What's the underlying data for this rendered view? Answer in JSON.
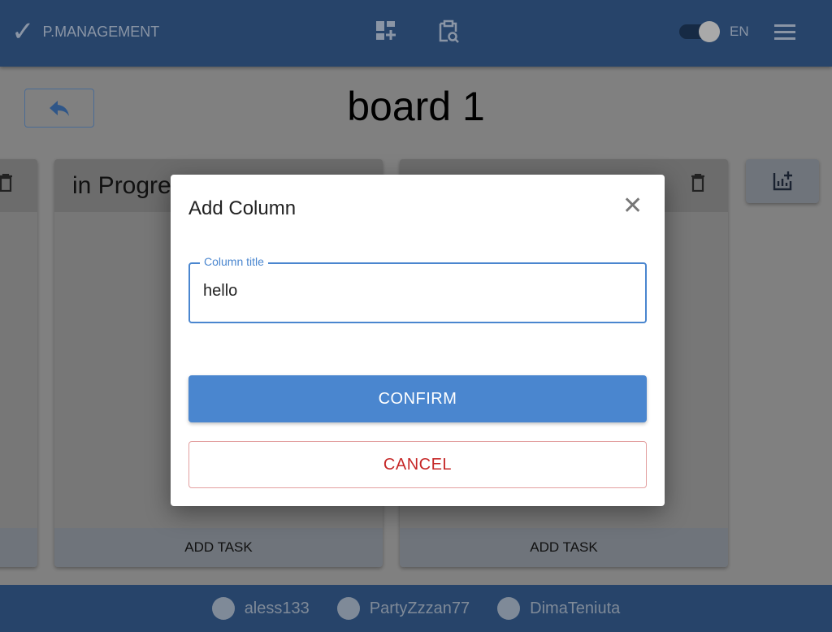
{
  "header": {
    "logo_text": "P.MANAGEMENT",
    "language": "EN",
    "theme_toggle_on": true,
    "icons": [
      "add-board-icon",
      "search-task-icon",
      "menu-icon"
    ]
  },
  "board": {
    "title": "board 1",
    "columns": [
      {
        "title": "",
        "add_task": ""
      },
      {
        "title": "in Progre",
        "add_task": "ADD TASK"
      },
      {
        "title": "",
        "add_task": "ADD TASK"
      }
    ]
  },
  "modal": {
    "title": "Add Column",
    "field_label": "Column title",
    "field_value": "hello",
    "confirm": "CONFIRM",
    "cancel": "CANCEL"
  },
  "footer": {
    "authors": [
      "aless133",
      "PartyZzzan77",
      "DimaTeniuta"
    ]
  },
  "colors": {
    "header": "#27446a",
    "accent": "#4a86cf",
    "cancel": "#c62828"
  }
}
